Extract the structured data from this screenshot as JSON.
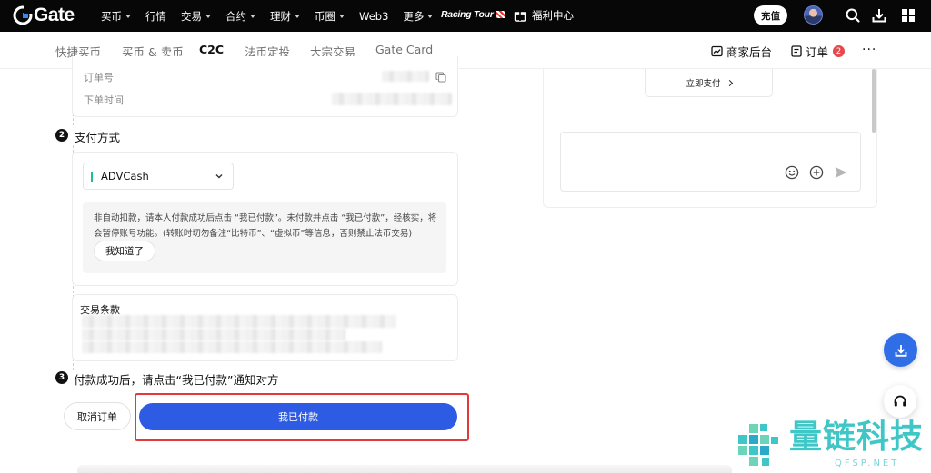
{
  "brand": {
    "name": "Gate",
    "accent": "#2e5be3",
    "danger": "#e23a3a"
  },
  "topnav": {
    "items": [
      {
        "label": "买币",
        "dropdown": true
      },
      {
        "label": "行情",
        "dropdown": false
      },
      {
        "label": "交易",
        "dropdown": true
      },
      {
        "label": "合约",
        "dropdown": true
      },
      {
        "label": "理财",
        "dropdown": true
      },
      {
        "label": "币圈",
        "dropdown": true
      },
      {
        "label": "Web3",
        "dropdown": false
      },
      {
        "label": "更多",
        "dropdown": true
      }
    ],
    "racing_label": "Racing Tour",
    "gift_label": "福利中心",
    "recharge_label": "充值",
    "icons": [
      "search-icon",
      "download-icon",
      "grid-icon"
    ]
  },
  "subnav": {
    "tabs": [
      {
        "label": "快捷买币",
        "active": false
      },
      {
        "label": "买币 & 卖币",
        "active": false
      },
      {
        "label": "C2C",
        "active": true
      },
      {
        "label": "法币定投",
        "active": false
      },
      {
        "label": "大宗交易",
        "active": false
      },
      {
        "label": "Gate Card",
        "active": false
      }
    ],
    "merchant_label": "商家后台",
    "orders_label": "订单",
    "orders_count": "2",
    "more_label": "···"
  },
  "order_info": {
    "order_no_label": "订单号",
    "order_time_label": "下单时间"
  },
  "step2": {
    "number": "2",
    "title": "支付方式",
    "payment_method": "ADVCash",
    "notice": "非自动扣款，请本人付款成功后点击 “我已付款”。未付款并点击 “我已付款”，经核实，将会暂停账号功能。(转账时切勿备注“比特币”、“虚拟币”等信息，否则禁止法币交易)",
    "ack_label": "我知道了",
    "terms_title": "交易条款"
  },
  "step3": {
    "number": "3",
    "title": "付款成功后，请点击“我已付款”通知对方"
  },
  "actions": {
    "cancel_label": "取消订单",
    "paid_label": "我已付款"
  },
  "chat": {
    "pay_now_label": "立即支付",
    "icons": [
      "emoji-icon",
      "plus-icon",
      "send-icon"
    ]
  },
  "watermark": {
    "text": "量链科技",
    "sub": "QFSP.NET"
  }
}
